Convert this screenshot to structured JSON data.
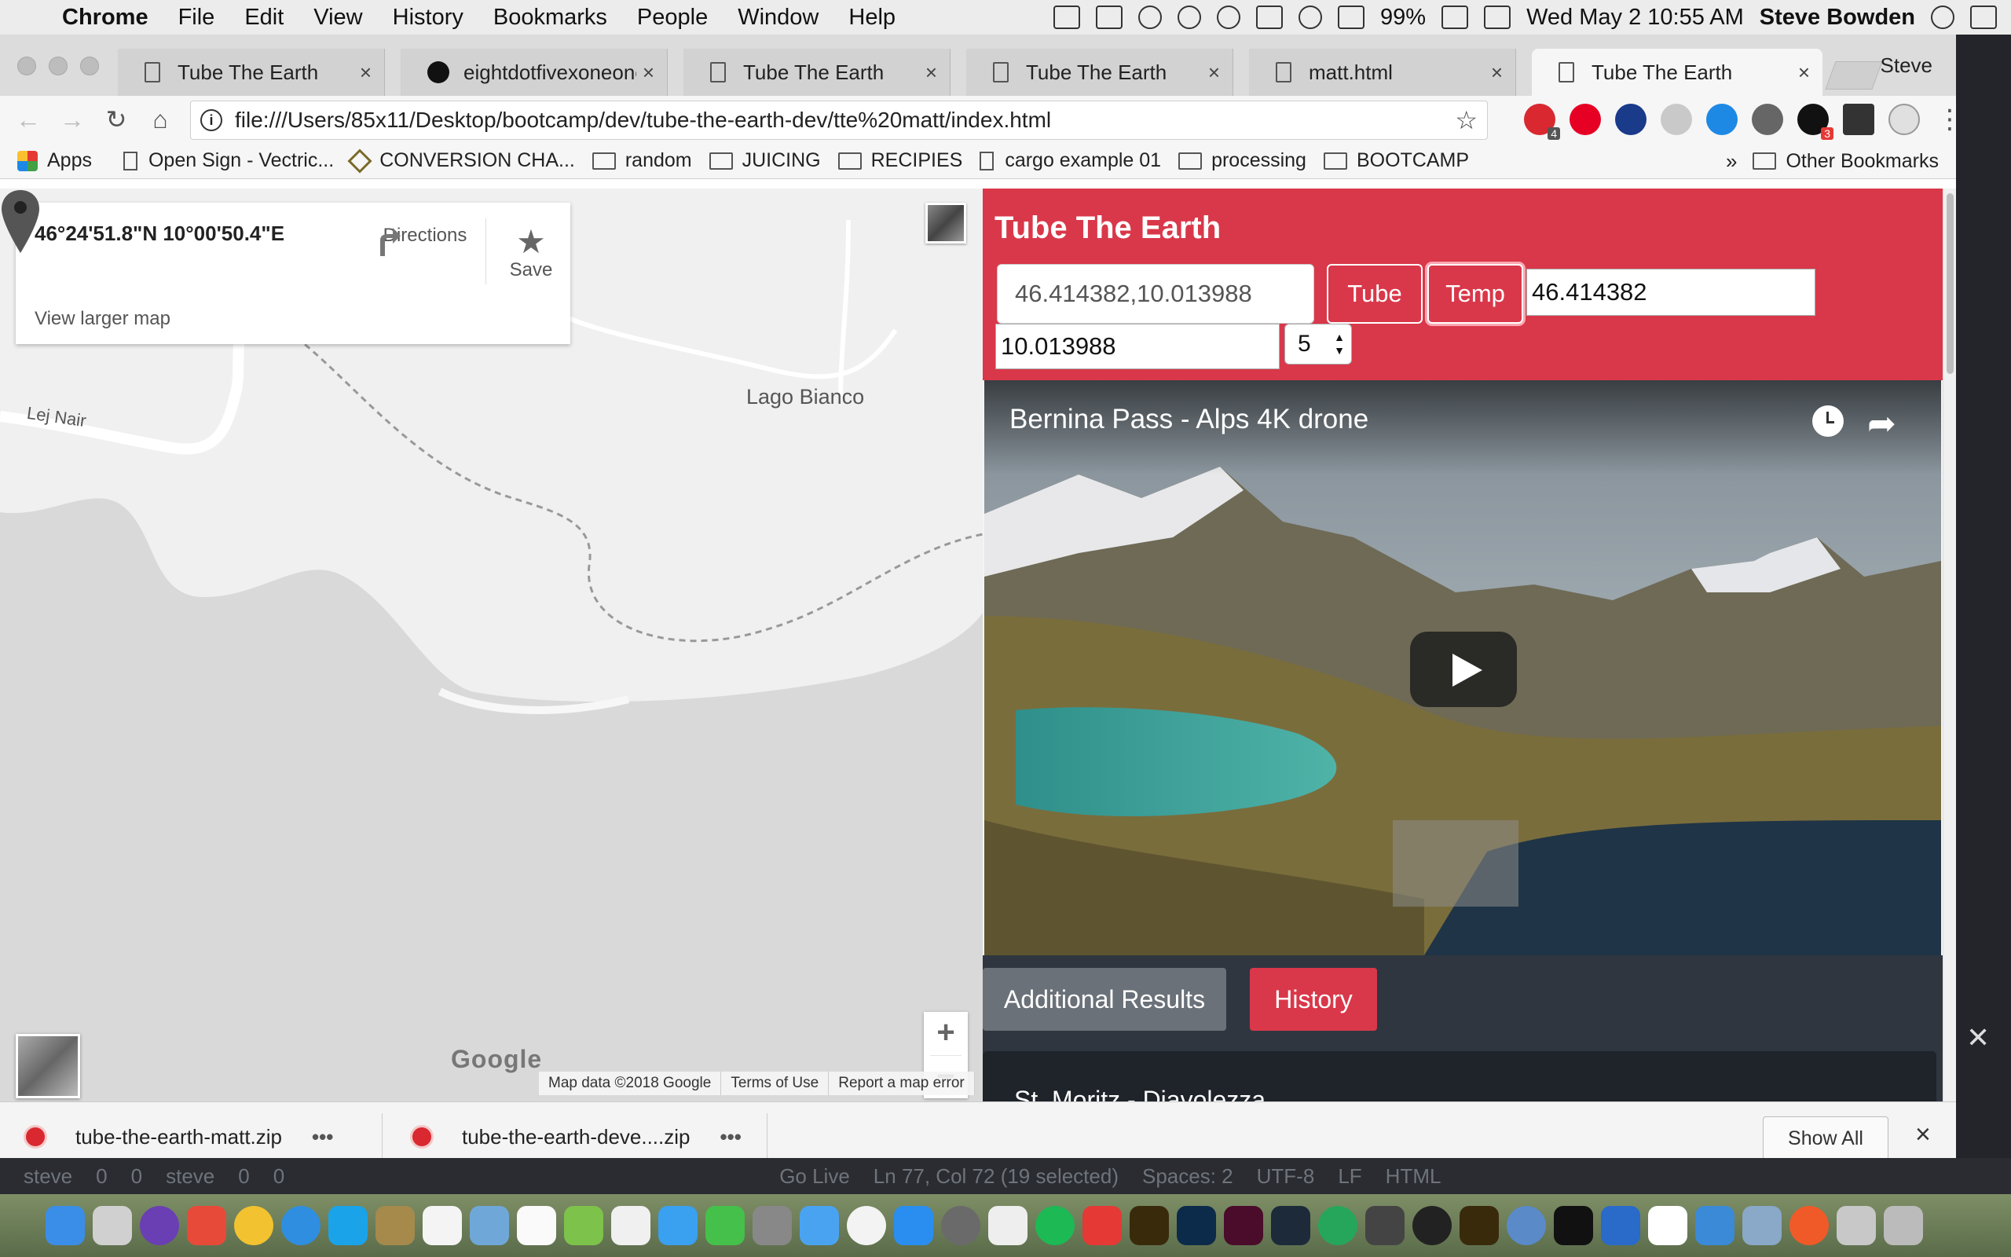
{
  "menubar": {
    "app": "Chrome",
    "items": [
      "File",
      "Edit",
      "View",
      "History",
      "Bookmarks",
      "People",
      "Window",
      "Help"
    ],
    "battery": "99%",
    "datetime": "Wed May 2  10:55 AM",
    "user": "Steve Bowden"
  },
  "tabs": [
    {
      "label": "Tube The Earth",
      "icon": "page-icon",
      "active": false
    },
    {
      "label": "eightdotfivexoneone/tu",
      "icon": "github-icon",
      "active": false
    },
    {
      "label": "Tube The Earth",
      "icon": "page-icon",
      "active": false
    },
    {
      "label": "Tube The Earth",
      "icon": "page-icon",
      "active": false
    },
    {
      "label": "matt.html",
      "icon": "page-icon",
      "active": false
    },
    {
      "label": "Tube The Earth",
      "icon": "page-icon",
      "active": true
    }
  ],
  "tab_close": "×",
  "profile": "Steve",
  "omnibox": {
    "url": "file:///Users/85x11/Desktop/bootcamp/dev/tube-the-earth-dev/tte%20matt/index.html"
  },
  "extensions": {
    "badge_1": "4",
    "badge_2": "3"
  },
  "bookmarks": {
    "items": [
      {
        "label": "Apps",
        "icon": "apps-icon"
      },
      {
        "label": "Open Sign - Vectric...",
        "icon": "doc-icon"
      },
      {
        "label": "CONVERSION CHA...",
        "icon": "diamond-icon"
      },
      {
        "label": "random",
        "icon": "folder-icon"
      },
      {
        "label": "JUICING",
        "icon": "folder-icon"
      },
      {
        "label": "RECIPIES",
        "icon": "folder-icon"
      },
      {
        "label": "cargo example 01",
        "icon": "doc-icon"
      },
      {
        "label": "processing",
        "icon": "folder-icon"
      },
      {
        "label": "BOOTCAMP",
        "icon": "folder-icon"
      }
    ],
    "overflow": "»",
    "other": "Other Bookmarks"
  },
  "map": {
    "coords": "46°24'51.8\"N 10°00'50.4\"E",
    "directions_label": "Directions",
    "save_label": "Save",
    "larger_map": "View larger map",
    "label_lago": "Lago Bianco",
    "label_lej": "Lej Nair",
    "zoom_in": "+",
    "zoom_out": "−",
    "logo": "Google",
    "footer": [
      "Map data ©2018 Google",
      "Terms of Use",
      "Report a map error"
    ]
  },
  "app": {
    "title": "Tube The Earth",
    "coord_input_value": "46.414382,10.013988",
    "tube_button": "Tube",
    "temp_button": "Temp",
    "lat_value": "46.414382",
    "lng_value": "10.013988",
    "count_value": "5",
    "video_title": "Bernina Pass - Alps 4K drone",
    "additional_results": "Additional Results",
    "history": "History",
    "first_result": "St. Moritz - Diavolezza",
    "header_color": "#d9384a"
  },
  "downloads": {
    "items": [
      {
        "name": "tube-the-earth-matt.zip"
      },
      {
        "name": "tube-the-earth-deve....zip"
      }
    ],
    "more": "•••",
    "show_all": "Show All",
    "close": "×"
  },
  "editor_status": [
    "steve",
    "0",
    "0",
    "steve",
    "0",
    "0",
    "Go Live",
    "Ln 77, Col 72 (19 selected)",
    "Spaces: 2",
    "UTF-8",
    "LF",
    "HTML"
  ]
}
